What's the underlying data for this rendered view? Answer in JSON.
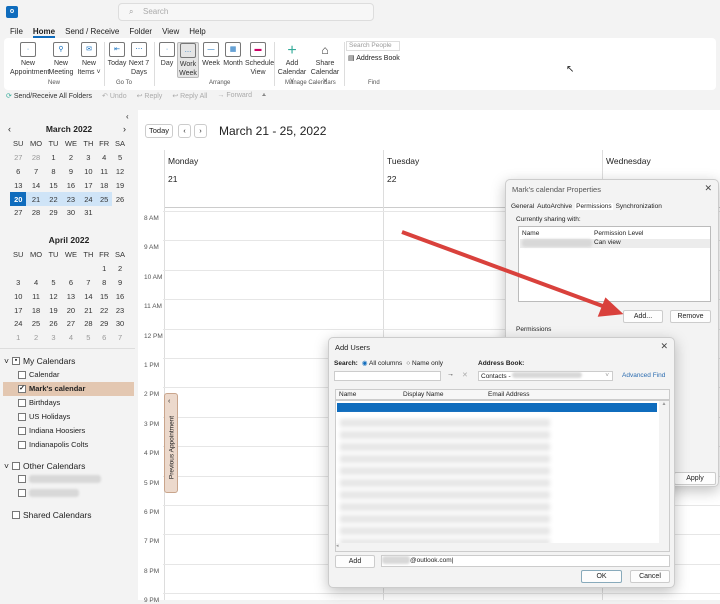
{
  "app": {
    "search_placeholder": "Search"
  },
  "menu": [
    "File",
    "Home",
    "Send / Receive",
    "Folder",
    "View",
    "Help"
  ],
  "ribbon": {
    "new_appointment": "New Appointment",
    "new_meeting": "New Meeting",
    "new_items": "New Items ˅",
    "group_new": "New",
    "today": "Today",
    "next7": "Next 7 Days",
    "group_goto": "Go To",
    "day": "Day",
    "work_week": "Work Week",
    "week": "Week",
    "month": "Month",
    "schedule_view": "Schedule View",
    "group_arrange": "Arrange",
    "add_calendar": "Add Calendar ˅",
    "share_calendar": "Share Calendar ˅",
    "group_manage": "Manage Calendars",
    "search_people": "Search People",
    "address_book": "Address Book",
    "group_find": "Find"
  },
  "qat": {
    "send_receive": "Send/Receive All Folders",
    "undo": "Undo",
    "reply": "Reply",
    "reply_all": "Reply All",
    "forward": "Forward"
  },
  "mini_cal": [
    {
      "title": "March 2022",
      "days": [
        "SU",
        "MO",
        "TU",
        "WE",
        "TH",
        "FR",
        "SA"
      ],
      "weeks": [
        [
          "27",
          "28",
          "1",
          "2",
          "3",
          "4",
          "5"
        ],
        [
          "6",
          "7",
          "8",
          "9",
          "10",
          "11",
          "12"
        ],
        [
          "13",
          "14",
          "15",
          "16",
          "17",
          "18",
          "19"
        ],
        [
          "20",
          "21",
          "22",
          "23",
          "24",
          "25",
          "26"
        ],
        [
          "27",
          "28",
          "29",
          "30",
          "31",
          "",
          ""
        ]
      ]
    },
    {
      "title": "April 2022",
      "days": [
        "SU",
        "MO",
        "TU",
        "WE",
        "TH",
        "FR",
        "SA"
      ],
      "weeks": [
        [
          "",
          "",
          "",
          "",
          "",
          "1",
          "2"
        ],
        [
          "3",
          "4",
          "5",
          "6",
          "7",
          "8",
          "9"
        ],
        [
          "10",
          "11",
          "12",
          "13",
          "14",
          "15",
          "16"
        ],
        [
          "17",
          "18",
          "19",
          "20",
          "21",
          "22",
          "23"
        ],
        [
          "24",
          "25",
          "26",
          "27",
          "28",
          "29",
          "30"
        ],
        [
          "1",
          "2",
          "3",
          "4",
          "5",
          "6",
          "7"
        ]
      ]
    }
  ],
  "folders": {
    "my_calendars": "My Calendars",
    "items": [
      "Calendar",
      "Mark's calendar",
      "Birthdays",
      "US Holidays",
      "Indiana Hoosiers",
      "Indianapolis Colts"
    ],
    "other_calendars": "Other Calendars",
    "shared_calendars": "Shared Calendars"
  },
  "calendar": {
    "today": "Today",
    "range": "March 21 - 25, 2022",
    "days": [
      {
        "name": "Monday",
        "num": "21"
      },
      {
        "name": "Tuesday",
        "num": "22"
      },
      {
        "name": "Wednesday",
        "num": ""
      }
    ],
    "times": [
      "8 AM",
      "9 AM",
      "10 AM",
      "11 AM",
      "12 PM",
      "1 PM",
      "2 PM",
      "3 PM",
      "4 PM",
      "5 PM",
      "6 PM",
      "7 PM",
      "8 PM",
      "9 PM"
    ],
    "prev_appt": "Previous Appointment"
  },
  "props": {
    "title": "Mark's calendar Properties",
    "tabs": [
      "General",
      "AutoArchive",
      "Permissions",
      "Synchronization"
    ],
    "sharing": "Currently sharing with:",
    "col_name": "Name",
    "col_level": "Permission Level",
    "row_level": "Can view",
    "add": "Add...",
    "remove": "Remove",
    "permissions": "Permissions",
    "apply": "Apply"
  },
  "add_users": {
    "title": "Add Users",
    "search_label": "Search:",
    "all_columns": "All columns",
    "name_only": "Name only",
    "address_book": "Address Book:",
    "contacts": "Contacts -",
    "advanced_find": "Advanced Find",
    "cols": [
      "Name",
      "Display Name",
      "Email Address"
    ],
    "add": "Add",
    "email_value": "@outlook.com",
    "ok": "OK",
    "cancel": "Cancel"
  }
}
